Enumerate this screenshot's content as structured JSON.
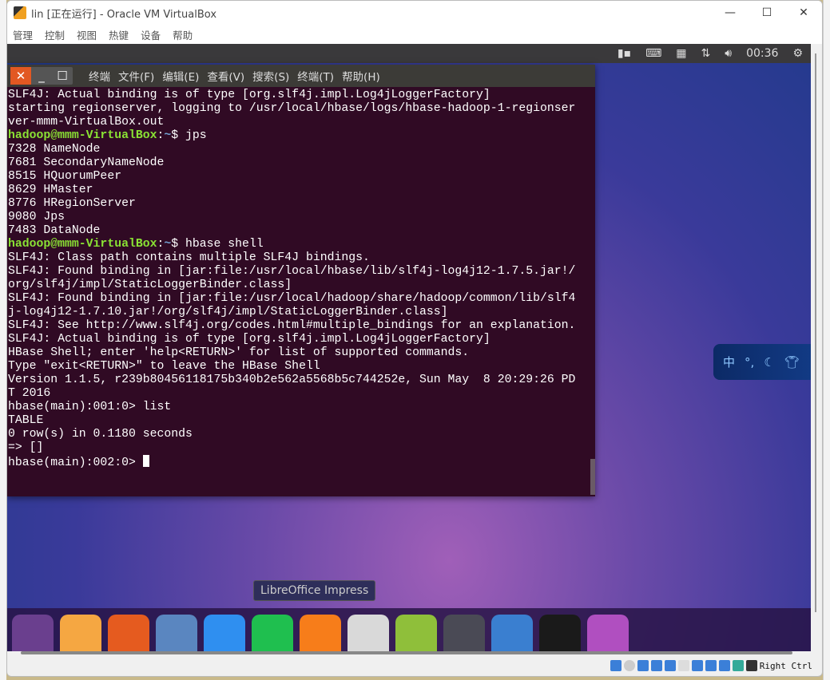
{
  "window": {
    "title": "lin [正在运行] - Oracle VM VirtualBox",
    "menu": [
      "管理",
      "控制",
      "视图",
      "热键",
      "设备",
      "帮助"
    ],
    "controls": [
      "—",
      "☐",
      "✕"
    ]
  },
  "panel": {
    "clock": "00:36",
    "icons": [
      "network-icon",
      "keyboard-icon",
      "calendar-icon",
      "transfer-icon",
      "volume-icon",
      "settings-icon"
    ]
  },
  "terminal": {
    "menu": [
      "终端",
      "文件(F)",
      "编辑(E)",
      "查看(V)",
      "搜索(S)",
      "终端(T)",
      "帮助(H)"
    ],
    "lines": [
      "SLF4J: Actual binding is of type [org.slf4j.impl.Log4jLoggerFactory]",
      "starting regionserver, logging to /usr/local/hbase/logs/hbase-hadoop-1-regionser",
      "ver-mmm-VirtualBox.out",
      {
        "user": "hadoop@mmm-VirtualBox",
        "path": "~",
        "cmd": "$ jps"
      },
      "7328 NameNode",
      "7681 SecondaryNameNode",
      "8515 HQuorumPeer",
      "8629 HMaster",
      "8776 HRegionServer",
      "9080 Jps",
      "7483 DataNode",
      {
        "user": "hadoop@mmm-VirtualBox",
        "path": "~",
        "cmd": "$ hbase shell"
      },
      "SLF4J: Class path contains multiple SLF4J bindings.",
      "SLF4J: Found binding in [jar:file:/usr/local/hbase/lib/slf4j-log4j12-1.7.5.jar!/",
      "org/slf4j/impl/StaticLoggerBinder.class]",
      "SLF4J: Found binding in [jar:file:/usr/local/hadoop/share/hadoop/common/lib/slf4",
      "j-log4j12-1.7.10.jar!/org/slf4j/impl/StaticLoggerBinder.class]",
      "SLF4J: See http://www.slf4j.org/codes.html#multiple_bindings for an explanation.",
      "SLF4J: Actual binding is of type [org.slf4j.impl.Log4jLoggerFactory]",
      "HBase Shell; enter 'help<RETURN>' for list of supported commands.",
      "Type \"exit<RETURN>\" to leave the HBase Shell",
      "Version 1.1.5, r239b80456118175b340b2e562a5568b5c744252e, Sun May  8 20:29:26 PD",
      "T 2016",
      "",
      "hbase(main):001:0> list",
      "TABLE",
      "0 row(s) in 0.1180 seconds",
      "",
      "=> []",
      "hbase(main):002:0> "
    ]
  },
  "ime": {
    "label": "中",
    "extra": "°,"
  },
  "dock": {
    "tooltip": "LibreOffice Impress",
    "apps": [
      "ubuntu",
      "files",
      "firefox",
      "chromium",
      "word",
      "excel",
      "powerpoint",
      "software-center",
      "robot",
      "terminal",
      "dash",
      "qq",
      "editor"
    ],
    "colors": [
      "#6a3f8e",
      "#f5a742",
      "#e55b1f",
      "#5a86c0",
      "#2f8ff0",
      "#1fbf4f",
      "#f77d1a",
      "#d9d9d9",
      "#8fbf3a",
      "#4a4a55",
      "#3a7fd0",
      "#1a1a1a",
      "#b04fc0"
    ]
  },
  "status": {
    "host_key": "Right Ctrl"
  }
}
